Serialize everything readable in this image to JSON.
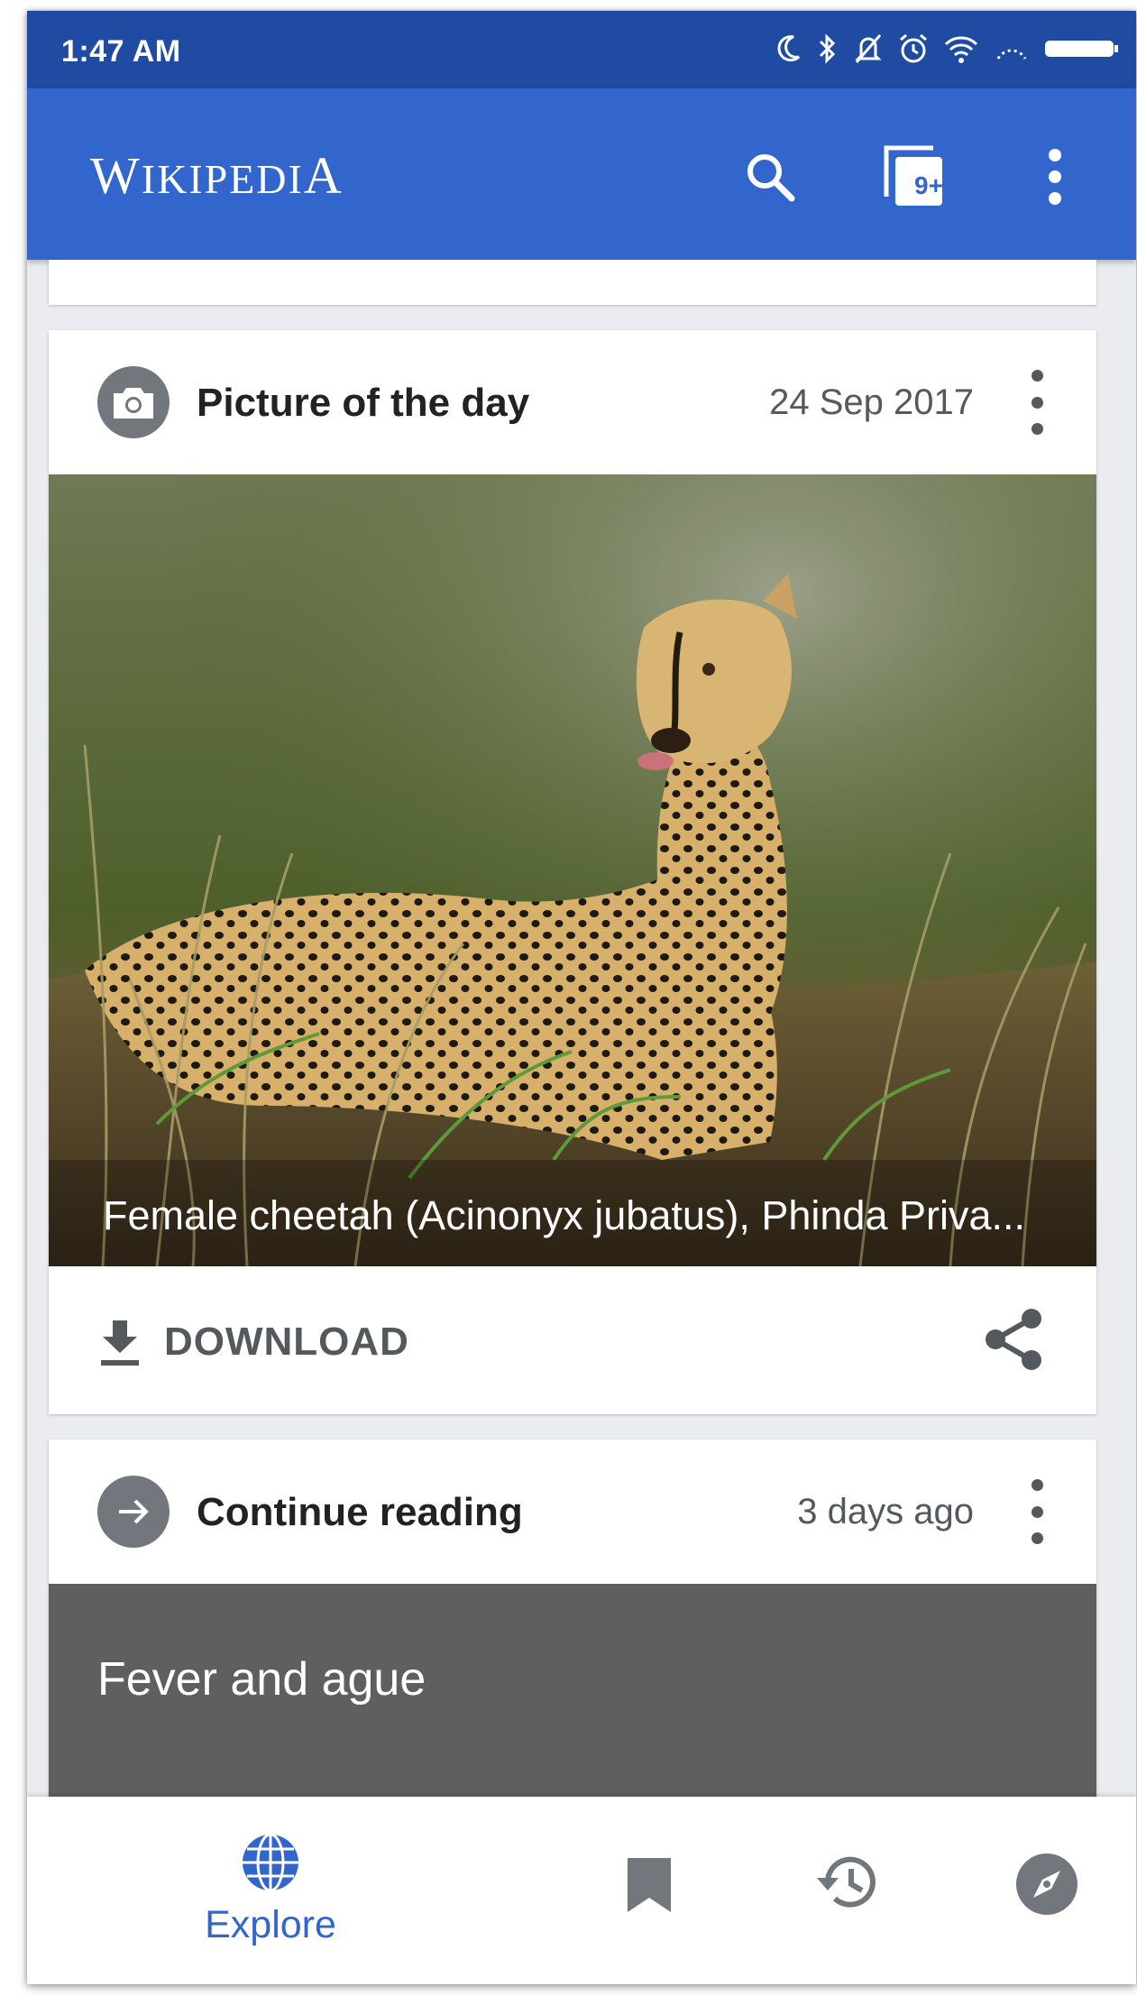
{
  "status_bar": {
    "time": "1:47 AM",
    "icons": [
      "moon-icon",
      "bluetooth-icon",
      "notifications-off-icon",
      "alarm-icon",
      "wifi-icon",
      "signal-icon",
      "battery-icon"
    ]
  },
  "app_bar": {
    "logo": "WIKIPEDIA",
    "logo_first": "W",
    "logo_mid": "IKIPEDI",
    "logo_last": "A",
    "tabs_badge": "9+",
    "icons": [
      "search-icon",
      "tabs-icon",
      "overflow-menu-icon"
    ]
  },
  "picture_card": {
    "title": "Picture of the day",
    "date": "24 Sep 2017",
    "caption": "Female cheetah (Acinonyx jubatus), Phinda Priva...",
    "download_label": "DOWNLOAD"
  },
  "continue_card": {
    "title": "Continue reading",
    "date": "3 days ago",
    "article_title": "Fever and ague"
  },
  "bottom_nav": {
    "explore_label": "Explore",
    "items": [
      "explore-icon",
      "bookmark-icon",
      "history-icon",
      "compass-icon"
    ]
  },
  "colors": {
    "status_bar": "#1f4ba3",
    "app_bar": "#3366cc",
    "accent": "#3366cc",
    "icon_gray": "#72777d",
    "continue_bg": "#5f5f5f"
  }
}
